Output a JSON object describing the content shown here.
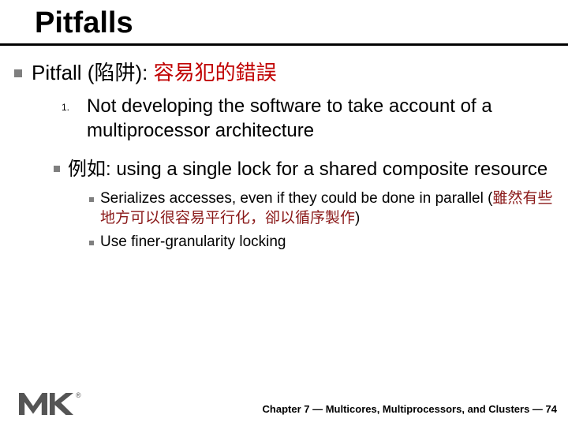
{
  "title": "Pitfalls",
  "heading": {
    "plain": "Pitfall (陷阱): ",
    "highlight": "容易犯的錯誤"
  },
  "item1": {
    "marker": "1.",
    "text": "Not developing the software to take account of a multiprocessor architecture"
  },
  "item2": {
    "text": "例如: using a single lock for a shared composite resource"
  },
  "sub1": {
    "prefix": "Serializes accesses, even if they could be done in parallel (",
    "red": "雖然有些地方可以很容易平行化，卻以循序製作",
    "suffix": ")"
  },
  "sub2": {
    "text": "Use finer-granularity locking"
  },
  "footer": {
    "reg": "®",
    "text": "Chapter 7 — Multicores, Multiprocessors, and Clusters — 74"
  }
}
